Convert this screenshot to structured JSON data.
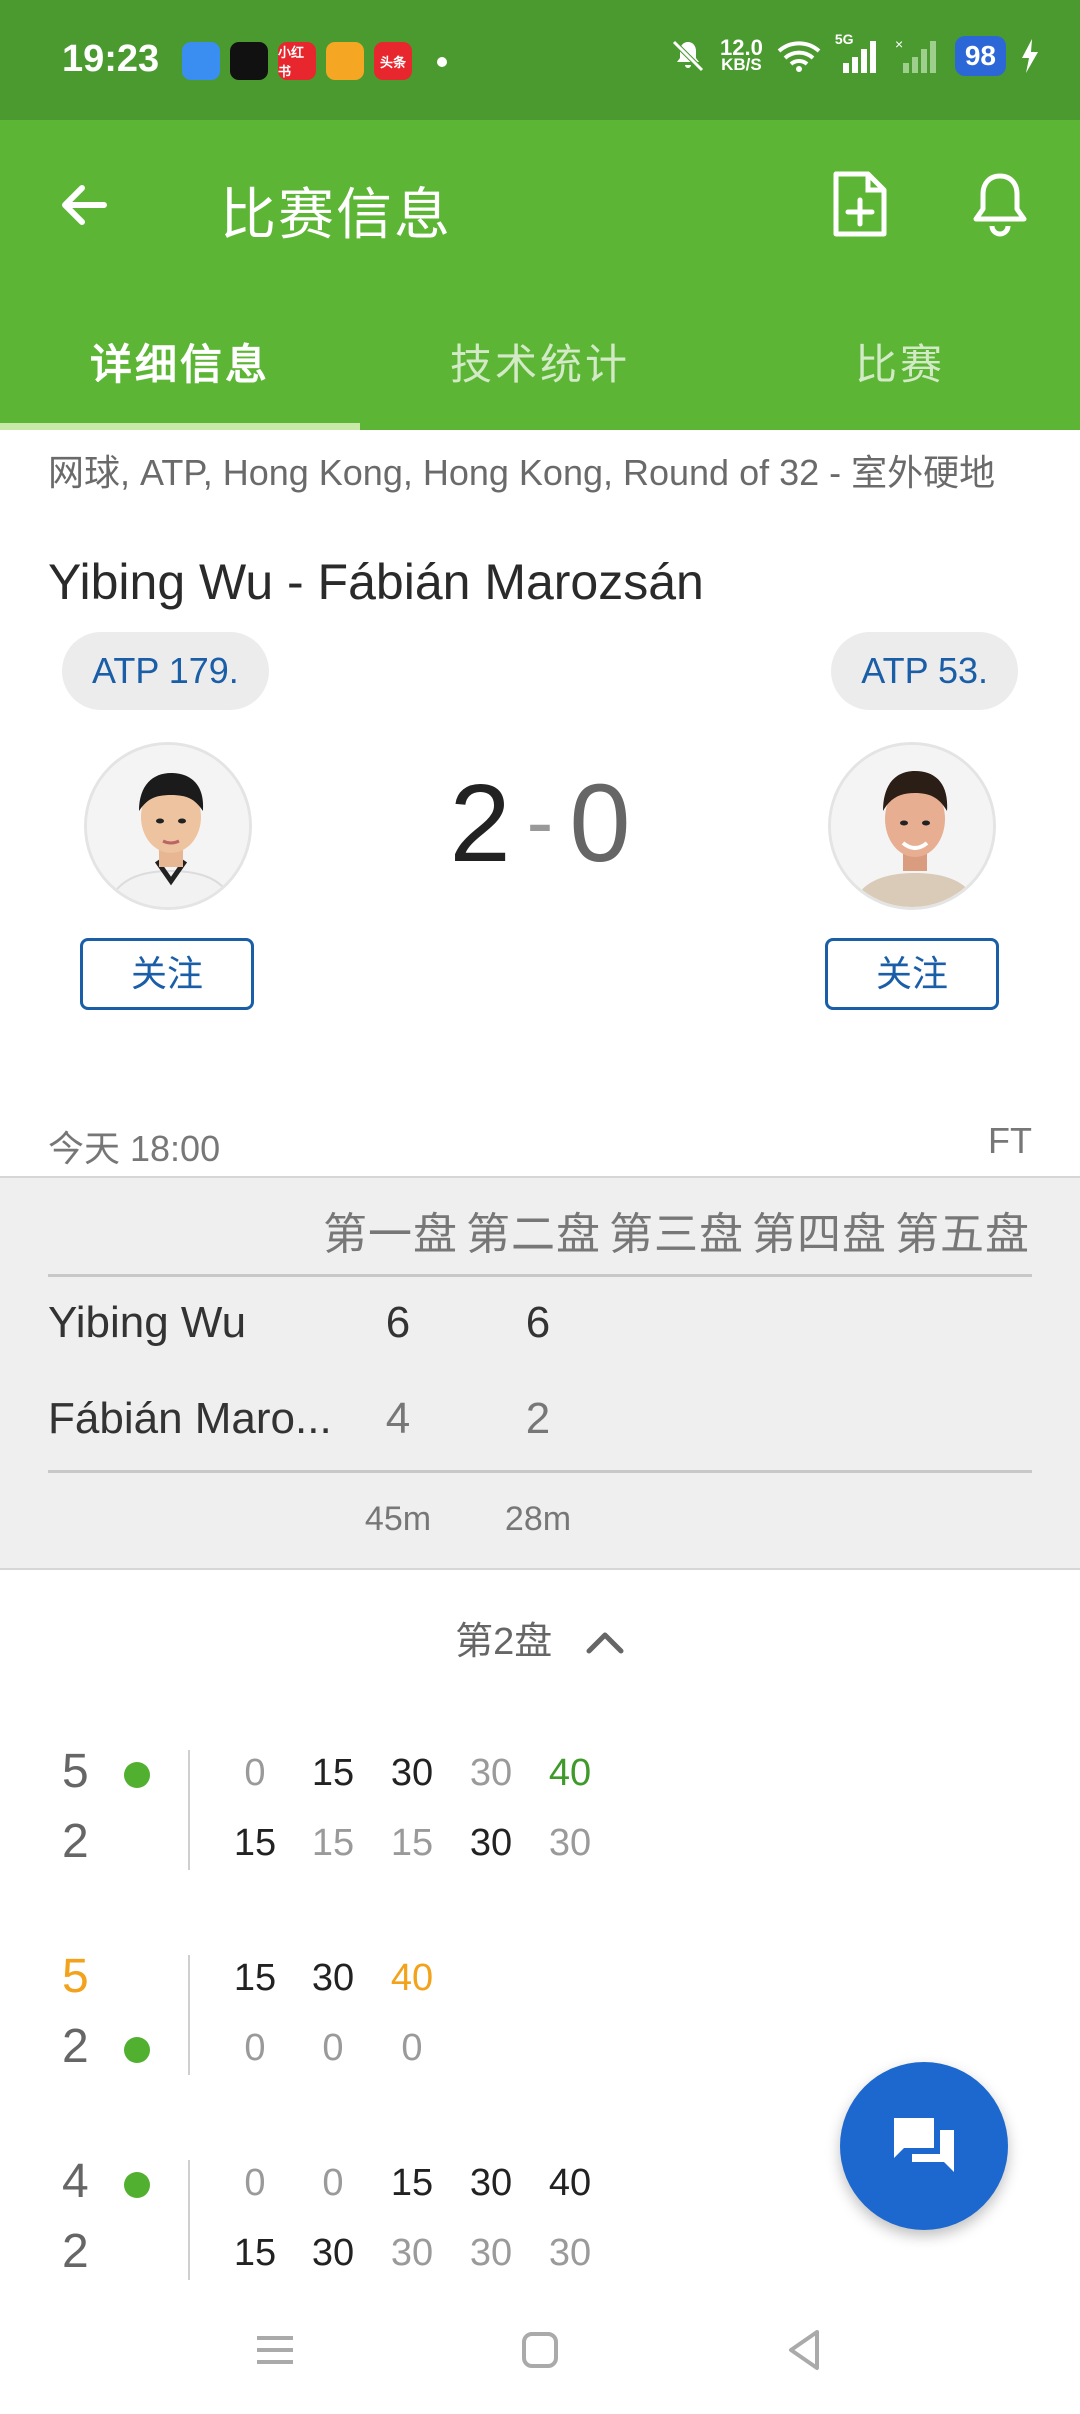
{
  "status_bar": {
    "time": "19:23",
    "apps": [
      {
        "name": "app-icon-1",
        "label": "",
        "color": "#3a8ef2"
      },
      {
        "name": "app-icon-2",
        "label": "",
        "color": "#111111"
      },
      {
        "name": "app-icon-3",
        "label": "小红书",
        "color": "#e8262d"
      },
      {
        "name": "app-icon-4",
        "label": "",
        "color": "#f5a623"
      },
      {
        "name": "app-icon-5",
        "label": "头条",
        "color": "#e8262d"
      }
    ],
    "speed_value": "12.0",
    "speed_unit": "KB/S",
    "network": "5G",
    "battery": "98"
  },
  "app_bar": {
    "title": "比赛信息",
    "tabs": [
      {
        "label": "详细信息",
        "active": true
      },
      {
        "label": "技术统计",
        "active": false
      },
      {
        "label": "比赛",
        "active": false
      }
    ]
  },
  "match": {
    "tournament": "网球, ATP, Hong Kong, Hong Kong, Round of 32 - 室外硬地",
    "title": "Yibing Wu - Fábián Marozsán",
    "player1_rank": "ATP 179.",
    "player2_rank": "ATP 53.",
    "score_home": "2",
    "score_sep": "-",
    "score_away": "0",
    "follow_label": "关注",
    "time": "今天 18:00",
    "status": "FT"
  },
  "sets_table": {
    "headers": [
      "第一盘",
      "第二盘",
      "第三盘",
      "第四盘",
      "第五盘"
    ],
    "players": [
      {
        "name": "Yibing Wu",
        "scores": [
          "6",
          "6"
        ]
      },
      {
        "name": "Fábián Maro...",
        "scores": [
          "4",
          "2"
        ]
      }
    ],
    "durations": [
      "45m",
      "28m"
    ]
  },
  "set_toggle": {
    "label": "第2盘"
  },
  "games": [
    {
      "top_score": "5",
      "bottom_score": "2",
      "serve": "top",
      "top_orange": false,
      "top_points": [
        [
          "0",
          "light"
        ],
        [
          "15",
          "dark"
        ],
        [
          "30",
          "dark"
        ],
        [
          "30",
          "light"
        ],
        [
          "40",
          "green"
        ]
      ],
      "bottom_points": [
        [
          "15",
          "dark"
        ],
        [
          "15",
          "light"
        ],
        [
          "15",
          "light"
        ],
        [
          "30",
          "dark"
        ],
        [
          "30",
          "light"
        ]
      ]
    },
    {
      "top_score": "5",
      "bottom_score": "2",
      "serve": "bottom",
      "top_orange": true,
      "top_points": [
        [
          "15",
          "dark"
        ],
        [
          "30",
          "dark"
        ],
        [
          "40",
          "orange"
        ]
      ],
      "bottom_points": [
        [
          "0",
          "light"
        ],
        [
          "0",
          "light"
        ],
        [
          "0",
          "light"
        ]
      ]
    },
    {
      "top_score": "4",
      "bottom_score": "2",
      "serve": "top",
      "top_orange": false,
      "top_points": [
        [
          "0",
          "light"
        ],
        [
          "0",
          "light"
        ],
        [
          "15",
          "dark"
        ],
        [
          "30",
          "dark"
        ],
        [
          "40",
          "dark"
        ]
      ],
      "bottom_points": [
        [
          "15",
          "dark"
        ],
        [
          "30",
          "dark"
        ],
        [
          "30",
          "light"
        ],
        [
          "30",
          "light"
        ],
        [
          "30",
          "light"
        ]
      ]
    }
  ],
  "colors": {
    "status_bar": "#4a9a30",
    "app_bar": "#5db535",
    "link_blue": "#1a5ea8",
    "serve_green": "#52b030",
    "fab_blue": "#1d68cf"
  }
}
